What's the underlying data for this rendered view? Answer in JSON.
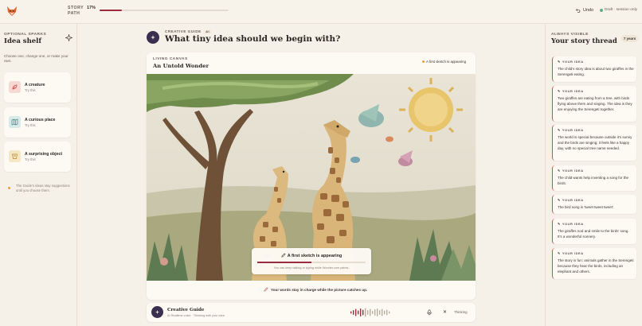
{
  "topbar": {
    "story_label_1": "STORY",
    "story_label_2": "PATH",
    "progress_text": "17%",
    "progress": 0.17,
    "undo_label": "Undo",
    "draft_label": "Draft · session only"
  },
  "left": {
    "eyebrow": "OPTIONAL SPARKS",
    "title": "Idea shelf",
    "hint": "Choose one, change one, or make your own.",
    "cards": [
      {
        "label": "A creature",
        "sub": "Try this"
      },
      {
        "label": "A curious place",
        "sub": "Try this"
      },
      {
        "label": "A surprising object",
        "sub": "Try this"
      }
    ],
    "footnote": "The Guide's ideas stay suggestions until you choose them."
  },
  "center": {
    "guide_eyebrow": "CREATIVE GUIDE",
    "ai_badge": "AI",
    "question": "What tiny idea should we begin with?",
    "canvas_eyebrow": "LIVING CANVAS",
    "canvas_title": "An Untold Wonder",
    "sketch_badge": "A first sketch is appearing",
    "overlay_title": "A first sketch is appearing",
    "overlay_sub": "You can keep talking or typing while Wonder.com paints.",
    "overlay_progress": 0.5,
    "canvas_footer": "Your words stay in charge while the picture catches up."
  },
  "guidebar": {
    "name": "Creative Guide",
    "sub": "AI Realtime voice · Thinking with your idea",
    "status": "Thinking"
  },
  "right": {
    "eyebrow": "ALWAYS VISIBLE",
    "title": "Your story thread",
    "age_badge": "7 years",
    "idea_label": "YOUR IDEA",
    "ideas": [
      "The child's story idea is about two giraffes in the Serengeti eating.",
      "Two giraffes are eating from a tree, with birds flying above them and singing. The idea is they are enjoying the Serengeti together.",
      "The world is special because outside it's sunny and the birds are singing; it feels like a happy day, with no special tree name needed.",
      "The child wants help inventing a song for the birds.",
      "The bird song is 'tweet tweet tweet'.",
      "The giraffes nod and smile to the birds' song. It's a wonderful scenery.",
      "The story is fun: animals gather in the Serengeti because they hear the birds, including an elephant and others."
    ]
  },
  "colors": {
    "accent": "#9b2b3d",
    "guide": "#3a2f4e",
    "background": "#f6f1e8",
    "card": "#fdfaf4"
  },
  "icons": [
    "fox-logo-icon",
    "undo-icon",
    "sparkle-icon",
    "creature-icon",
    "map-icon",
    "object-icon",
    "pencil-icon",
    "mic-icon",
    "close-icon",
    "waveform-icon"
  ]
}
